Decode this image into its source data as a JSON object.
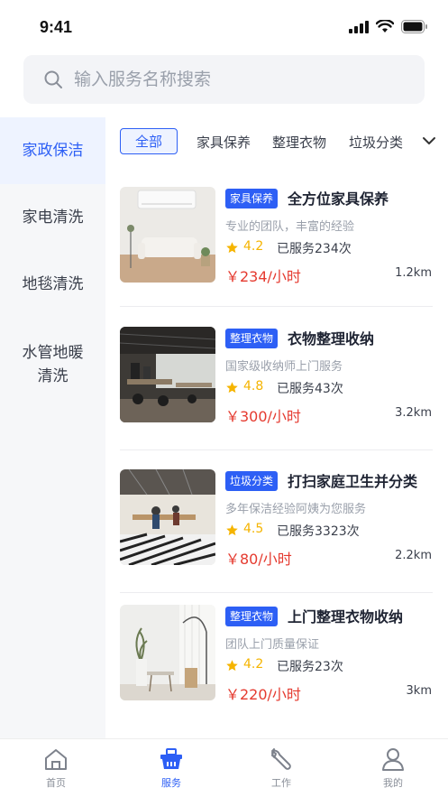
{
  "status_bar": {
    "time": "9:41"
  },
  "search": {
    "placeholder": "输入服务名称搜索"
  },
  "sidebar": {
    "items": [
      {
        "label": "家政保洁",
        "active": true
      },
      {
        "label": "家电清洗",
        "active": false
      },
      {
        "label": "地毯清洗",
        "active": false
      },
      {
        "label": "水管地暖\n清洗",
        "active": false
      }
    ]
  },
  "tabs": {
    "all": "全部",
    "items": [
      "家具保养",
      "整理衣物",
      "垃圾分类"
    ]
  },
  "services": [
    {
      "tag": "家具保养",
      "title": "全方位家具保养",
      "desc": "专业的团队，丰富的经验",
      "rating": "4.2",
      "served": "已服务234次",
      "price": "￥234/小时",
      "distance": "1.2km"
    },
    {
      "tag": "整理衣物",
      "title": "衣物整理收纳",
      "desc": "国家级收纳师上门服务",
      "rating": "4.8",
      "served": "已服务43次",
      "price": "￥300/小时",
      "distance": "3.2km"
    },
    {
      "tag": "垃圾分类",
      "title": "打扫家庭卫生并分类",
      "desc": "多年保洁经验阿姨为您服务",
      "rating": "4.5",
      "served": "已服务3323次",
      "price": "￥80/小时",
      "distance": "2.2km"
    },
    {
      "tag": "整理衣物",
      "title": "上门整理衣物收纳",
      "desc": "团队上门质量保证",
      "rating": "4.2",
      "served": "已服务23次",
      "price": "￥220/小时",
      "distance": "3km"
    }
  ],
  "bottom_nav": {
    "items": [
      {
        "label": "首页",
        "icon": "home-icon"
      },
      {
        "label": "服务",
        "icon": "service-basket-icon",
        "active": true
      },
      {
        "label": "工作",
        "icon": "wrench-icon"
      },
      {
        "label": "我的",
        "icon": "profile-icon"
      }
    ]
  },
  "colors": {
    "accent": "#2d5ff5",
    "price": "#e53a2f",
    "star": "#f5b400"
  }
}
